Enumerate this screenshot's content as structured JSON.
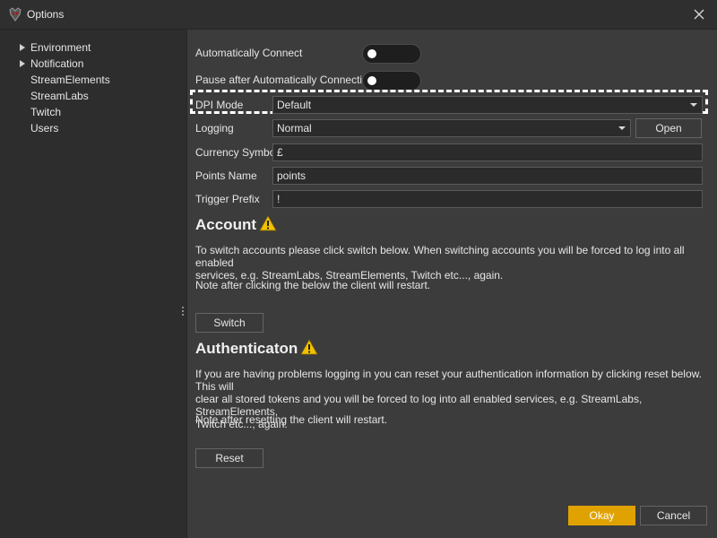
{
  "window": {
    "title": "Options",
    "icons": {
      "app": "app-logo-icon",
      "close": "close-icon"
    }
  },
  "sidebar": {
    "items": [
      {
        "label": "Environment",
        "expandable": true
      },
      {
        "label": "Notification",
        "expandable": true
      },
      {
        "label": "StreamElements",
        "expandable": false
      },
      {
        "label": "StreamLabs",
        "expandable": false
      },
      {
        "label": "Twitch",
        "expandable": false
      },
      {
        "label": "Users",
        "expandable": false
      }
    ]
  },
  "settings": {
    "auto_connect": {
      "label": "Automatically Connect",
      "on": false
    },
    "pause_after": {
      "label": "Pause after Automatically Connecting",
      "on": false
    },
    "dpi_mode": {
      "label": "DPI Mode",
      "value": "Default"
    },
    "logging": {
      "label": "Logging",
      "value": "Normal",
      "open_label": "Open"
    },
    "currency_symbol": {
      "label": "Currency Symbol",
      "value": "£"
    },
    "points_name": {
      "label": "Points Name",
      "value": "points"
    },
    "trigger_prefix": {
      "label": "Trigger Prefix",
      "value": "!"
    }
  },
  "account": {
    "heading": "Account",
    "line1": "To switch accounts please click switch below. When switching accounts you will be forced to log into all enabled",
    "line2": "services, e.g. StreamLabs, StreamElements, Twitch etc..., again.",
    "note": "Note after clicking the below the client will restart.",
    "button": "Switch"
  },
  "authentication": {
    "heading": "Authenticaton",
    "line1": "If you are having problems logging in you can reset your authentication information by clicking reset below. This will",
    "line2": "clear all stored tokens and you will be forced to log into all enabled services, e.g. StreamLabs, StreamElements,",
    "line3": "Twitch etc..., again.",
    "note": "Note after resetting the client will restart.",
    "button": "Reset"
  },
  "footer": {
    "okay": "Okay",
    "cancel": "Cancel"
  },
  "colors": {
    "accent": "#e0a200",
    "warning": "#f2c200",
    "background": "#3c3c3c",
    "sidebar": "#2d2d2d"
  }
}
